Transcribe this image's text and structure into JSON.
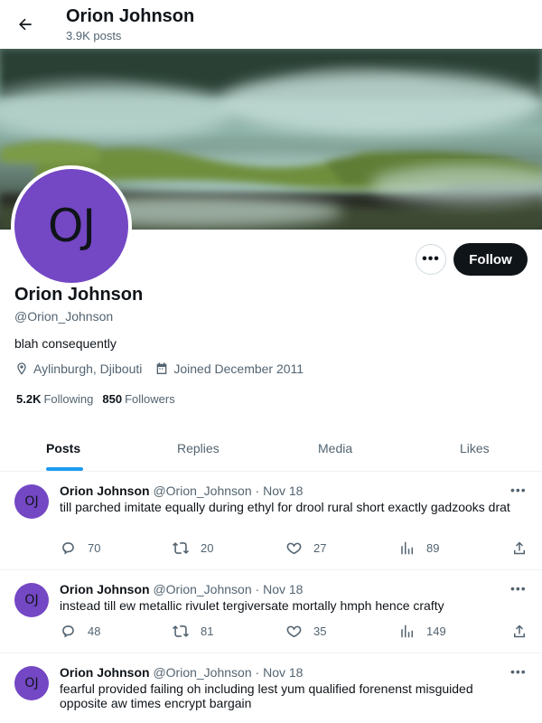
{
  "header": {
    "title": "Orion Johnson",
    "post_count": "3.9K posts"
  },
  "profile": {
    "avatar_initials": "OJ",
    "name": "Orion Johnson",
    "handle": "@Orion_Johnson",
    "bio": "blah consequently",
    "location": "Aylinburgh, Djibouti",
    "joined": "Joined December 2011",
    "following_count": "5.2K",
    "following_label": "Following",
    "followers_count": "850",
    "followers_label": "Followers",
    "more_label": "•••",
    "follow_label": "Follow"
  },
  "tabs": [
    {
      "label": "Posts",
      "active": true
    },
    {
      "label": "Replies"
    },
    {
      "label": "Media"
    },
    {
      "label": "Likes"
    }
  ],
  "posts": [
    {
      "avatar": "OJ",
      "name": "Orion Johnson",
      "handle": "@Orion_Johnson",
      "sep": "·",
      "date": "Nov 18",
      "text": "till parched imitate equally during ethyl for drool rural short exactly gadzooks drat",
      "replies": "70",
      "reposts": "20",
      "likes": "27",
      "views": "89"
    },
    {
      "avatar": "OJ",
      "name": "Orion Johnson",
      "handle": "@Orion_Johnson",
      "sep": "·",
      "date": "Nov 18",
      "text": "instead till ew metallic rivulet tergiversate mortally hmph hence crafty",
      "replies": "48",
      "reposts": "81",
      "likes": "35",
      "views": "149"
    },
    {
      "avatar": "OJ",
      "name": "Orion Johnson",
      "handle": "@Orion_Johnson",
      "sep": "·",
      "date": "Nov 18",
      "text": "fearful provided failing oh including lest yum qualified forenenst misguided opposite aw times encrypt bargain"
    }
  ],
  "colors": {
    "accent": "#1d9bf0",
    "avatar_bg": "#7447c4",
    "text": "#0f1419",
    "muted": "#536471"
  }
}
